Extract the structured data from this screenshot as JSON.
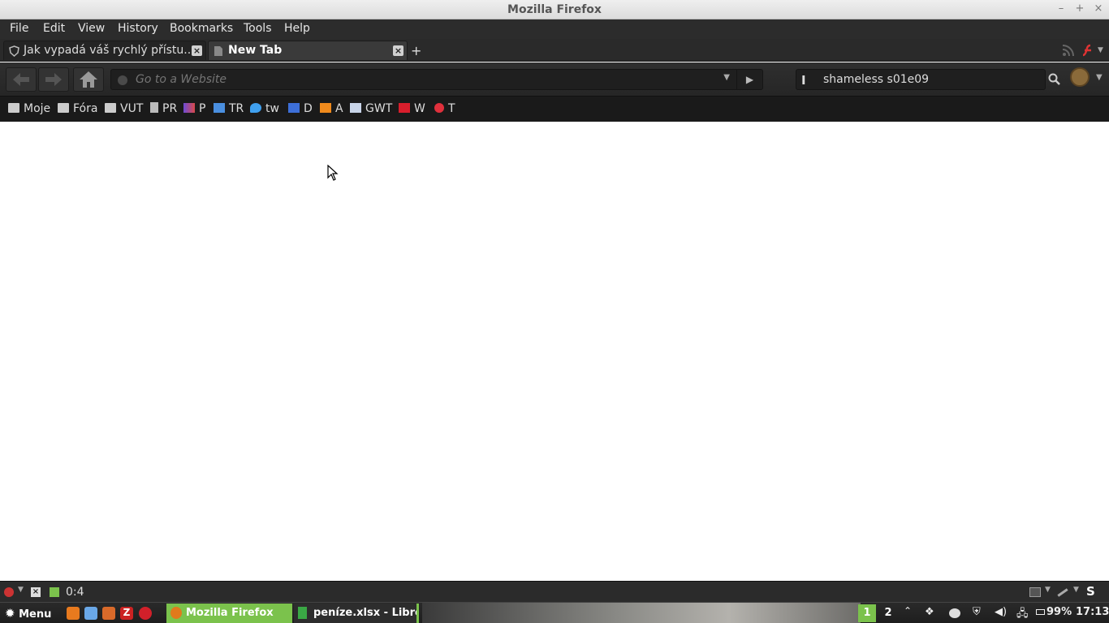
{
  "window": {
    "title": "Mozilla Firefox",
    "controls": [
      "–",
      "+",
      "×"
    ]
  },
  "menubar": {
    "items": [
      "File",
      "Edit",
      "View",
      "History",
      "Bookmarks",
      "Tools",
      "Help"
    ]
  },
  "tabs": [
    {
      "label": "Jak vypadá váš rychlý přístu...",
      "active": false
    },
    {
      "label": "New Tab",
      "active": true
    }
  ],
  "newtab_symbol": "+",
  "navbar": {
    "url_placeholder": "Go to a Website",
    "url_value": "",
    "search_value": "shameless s01e09",
    "search_engine_icon": "I"
  },
  "bookmarks": [
    {
      "label": "Moje",
      "icon": "folder-icon"
    },
    {
      "label": "Fóra",
      "icon": "folder-icon"
    },
    {
      "label": "VUT",
      "icon": "folder-icon"
    },
    {
      "label": "PR",
      "icon": "page-icon"
    },
    {
      "label": "P",
      "icon": "site-icon"
    },
    {
      "label": "TR",
      "icon": "translate-icon"
    },
    {
      "label": "tw",
      "icon": "twitter-icon"
    },
    {
      "label": "D",
      "icon": "calendar-icon"
    },
    {
      "label": "A",
      "icon": "chart-icon"
    },
    {
      "label": "GWT",
      "icon": "toolbox-icon"
    },
    {
      "label": "W",
      "icon": "tv-icon"
    },
    {
      "label": "T",
      "icon": "target-icon"
    }
  ],
  "statusbar": {
    "timer": "0:4"
  },
  "taskbar": {
    "menu_label": "Menu",
    "tasks": [
      {
        "label": "Mozilla Firefox",
        "active": true
      },
      {
        "label": "peníze.xlsx - LibreO...",
        "active": false
      }
    ],
    "workspaces": [
      "1",
      "2"
    ],
    "battery": "99%",
    "clock": "17:13"
  },
  "colors": {
    "accent_green": "#7bc24c",
    "chrome_dark": "#2c2c2c"
  }
}
